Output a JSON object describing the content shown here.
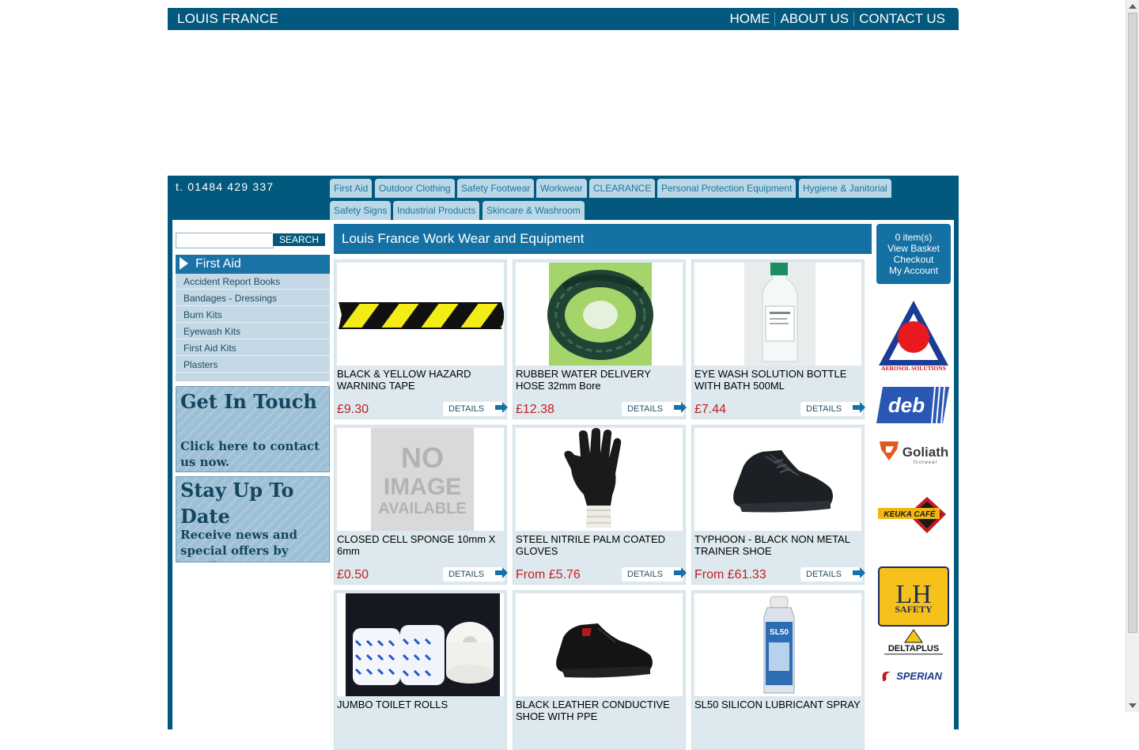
{
  "header": {
    "brand": "LOUIS FRANCE",
    "nav": [
      "HOME",
      "ABOUT US",
      "CONTACT US"
    ]
  },
  "phone": "t. 01484 429 337",
  "tabs": [
    "First Aid",
    "Outdoor Clothing",
    "Safety Footwear",
    "Workwear",
    "CLEARANCE",
    "Personal Protection Equipment",
    "Hygiene & Janitorial",
    "Safety Signs",
    "Industrial Products",
    "Skincare & Washroom"
  ],
  "search": {
    "button": "SEARCH",
    "value": ""
  },
  "sidebar": {
    "category": "First Aid",
    "subcategories": [
      "Accident Report Books",
      "Bandages - Dressings",
      "Burn Kits",
      "Eyewash Kits",
      "First Aid Kits",
      "Plasters"
    ],
    "promo_contact": {
      "heading": "Get In Touch",
      "line1": "Click here to contact",
      "line2": "us now."
    },
    "promo_news": {
      "heading1": "Stay Up To",
      "heading2": "Date",
      "line1": "Receive news and",
      "line2": "special offers by email."
    }
  },
  "main": {
    "title": "Louis France Work Wear and Equipment",
    "details_label": "DETAILS",
    "products": [
      {
        "name": "BLACK & YELLOW HAZARD WARNING TAPE",
        "price": "£9.30",
        "image": "hazard-tape"
      },
      {
        "name": "RUBBER WATER DELIVERY HOSE 32mm Bore",
        "price": "£12.38",
        "image": "hose"
      },
      {
        "name": "EYE WASH SOLUTION BOTTLE WITH BATH 500ML",
        "price": "£7.44",
        "image": "eyewash-bottle"
      },
      {
        "name": "CLOSED CELL SPONGE 10mm X 6mm",
        "price": "£0.50",
        "image": "no-image",
        "image_text": [
          "NO",
          "IMAGE",
          "AVAILABLE"
        ]
      },
      {
        "name": "STEEL NITRILE PALM COATED GLOVES",
        "price": "From £5.76",
        "image": "glove"
      },
      {
        "name": "TYPHOON - BLACK NON METAL TRAINER SHOE",
        "price": "From £61.33",
        "image": "trainer-shoe"
      },
      {
        "name": "JUMBO TOILET ROLLS",
        "price": "",
        "image": "toilet-rolls"
      },
      {
        "name": "BLACK LEATHER CONDUCTIVE SHOE WITH PPE",
        "price": "",
        "image": "leather-shoe"
      },
      {
        "name": "SL50 SILICON LUBRICANT SPRAY",
        "price": "",
        "image": "spray-can",
        "image_text": [
          "SL50"
        ]
      }
    ]
  },
  "basket": {
    "items": "0 item(s)",
    "view": "View Basket",
    "checkout": "Checkout",
    "account": "My Account"
  },
  "brand_logos": [
    {
      "name": "aerosol-solutions-logo",
      "text": "AEROSOL SOLUTIONS"
    },
    {
      "name": "deb-logo",
      "text": "deb"
    },
    {
      "name": "goliath-logo",
      "text": "Goliath",
      "sub": "footwear"
    },
    {
      "name": "keuka-cafe-logo",
      "text": "KEUKA CAFÉ"
    },
    {
      "name": "lh-safety-logo",
      "text": "LH",
      "sub": "SAFETY"
    },
    {
      "name": "deltaplus-logo",
      "text": "DELTAPLUS"
    },
    {
      "name": "sperian-logo",
      "text": "SPERIAN"
    }
  ],
  "colors": {
    "brand_blue": "#03597d",
    "accent_blue": "#1571a3",
    "price_red": "#c2201f",
    "tab_bg": "#b9d7e6"
  }
}
